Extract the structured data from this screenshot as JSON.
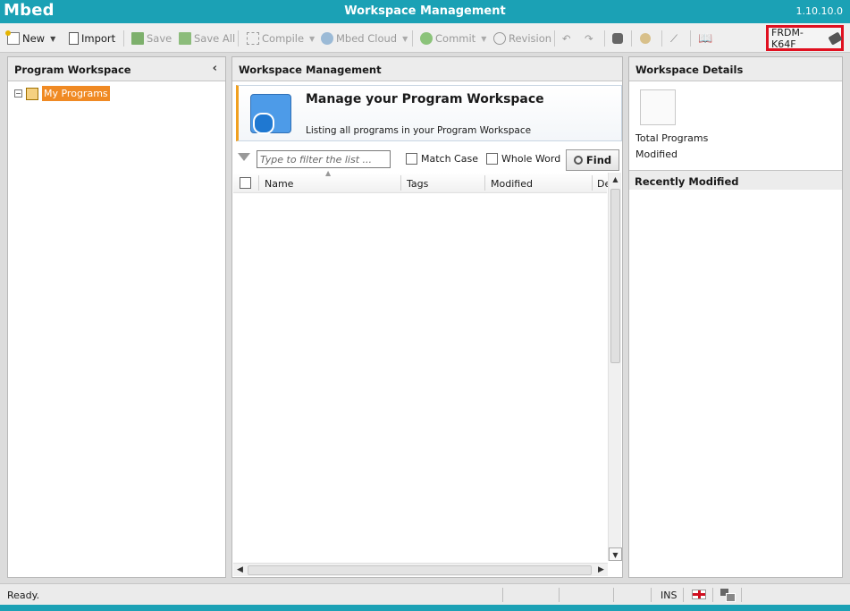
{
  "app": {
    "logo": "Mbed",
    "title": "Workspace Management",
    "version": "1.10.10.0"
  },
  "toolbar": {
    "new_label": "New",
    "import_label": "Import",
    "save_label": "Save",
    "save_all_label": "Save All",
    "compile_label": "Compile",
    "cloud_label": "Mbed Cloud",
    "commit_label": "Commit",
    "revision_label": "Revision",
    "device_label": "FRDM-K64F"
  },
  "left_panel": {
    "title": "Program Workspace",
    "tree_root": "My Programs"
  },
  "mid_panel": {
    "title": "Workspace Management",
    "banner_heading": "Manage your Program Workspace",
    "banner_sub": "Listing all programs in your Program Workspace",
    "filter_placeholder": "Type to filter the list ...",
    "match_case_label": "Match Case",
    "whole_word_label": "Whole Word",
    "find_label": "Find",
    "columns": [
      "Name",
      "Tags",
      "Modified",
      "De"
    ]
  },
  "right_panel": {
    "title": "Workspace Details",
    "total_programs_label": "Total Programs",
    "modified_label": "Modified",
    "recently_modified_title": "Recently Modified"
  },
  "statusbar": {
    "status": "Ready.",
    "ins": "INS"
  },
  "colors": {
    "titlebar": "#1ba1b5",
    "selection": "#f08a24",
    "device_highlight": "#e01020"
  }
}
